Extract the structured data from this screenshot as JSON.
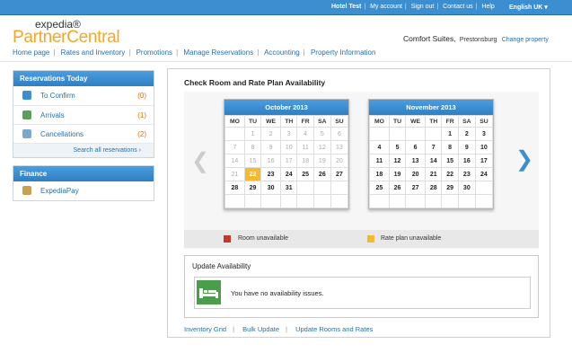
{
  "topbar": {
    "links": [
      "Hotel Test",
      "My account",
      "Sign out",
      "Contact us",
      "Help"
    ],
    "language": "English UK"
  },
  "logo": {
    "line1": "expedia®",
    "line2": "PartnerCentral"
  },
  "hotel": {
    "name": "Comfort Suites,",
    "city": "Prestonsburg",
    "change": "Change property"
  },
  "nav": [
    "Home page",
    "Rates and Inventory",
    "Promotions",
    "Manage Reservations",
    "Accounting",
    "Property Information"
  ],
  "reservations": {
    "title": "Reservations Today",
    "items": [
      {
        "label": "To Confirm",
        "count": "(0)"
      },
      {
        "label": "Arrivals",
        "count": "(1)"
      },
      {
        "label": "Cancellations",
        "count": "(2)"
      }
    ],
    "search_all": "Search all reservations ›"
  },
  "finance": {
    "title": "Finance",
    "item": "ExpediaPay"
  },
  "main": {
    "title": "Check Room and Rate Plan Availability",
    "prev_arrow": "❮",
    "next_arrow": "❯",
    "days": [
      "MO",
      "TU",
      "WE",
      "TH",
      "FR",
      "SA",
      "SU"
    ],
    "calendars": [
      {
        "month": "October 2013",
        "weeks": [
          [
            "",
            "1",
            "2",
            "3",
            "4",
            "5",
            "6"
          ],
          [
            "7",
            "8",
            "9",
            "10",
            "11",
            "12",
            "13"
          ],
          [
            "14",
            "15",
            "16",
            "17",
            "18",
            "19",
            "20"
          ],
          [
            "21",
            "22",
            "23",
            "24",
            "25",
            "26",
            "27"
          ],
          [
            "28",
            "29",
            "30",
            "31",
            "",
            "",
            ""
          ],
          [
            "",
            "",
            "",
            "",
            "",
            "",
            ""
          ]
        ]
      },
      {
        "month": "November 2013",
        "weeks": [
          [
            "",
            "",
            "",
            "",
            "1",
            "2",
            "3"
          ],
          [
            "4",
            "5",
            "6",
            "7",
            "8",
            "9",
            "10"
          ],
          [
            "11",
            "12",
            "13",
            "14",
            "15",
            "16",
            "17"
          ],
          [
            "18",
            "19",
            "20",
            "21",
            "22",
            "23",
            "24"
          ],
          [
            "25",
            "26",
            "27",
            "28",
            "29",
            "30",
            ""
          ],
          [
            "",
            "",
            "",
            "",
            "",
            "",
            ""
          ]
        ]
      }
    ],
    "legend": [
      {
        "label": "Room unavailable",
        "color": "#c0392b"
      },
      {
        "label": "Rate plan unavailable",
        "color": "#f5b930"
      }
    ],
    "update": {
      "title": "Update Availability",
      "message": "You have no availability issues."
    },
    "footer_links": [
      "Inventory Grid",
      "Bulk Update",
      "Update Rooms and Rates"
    ]
  }
}
